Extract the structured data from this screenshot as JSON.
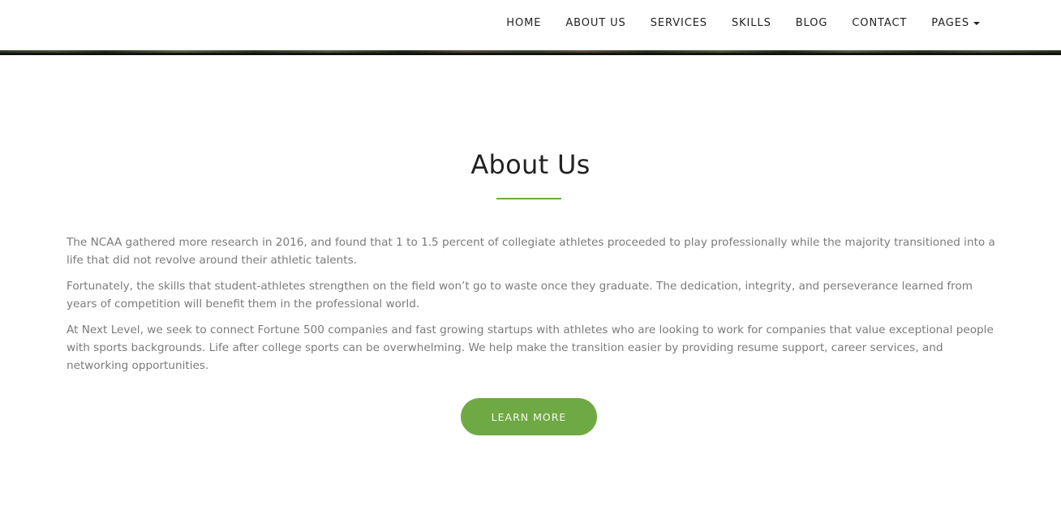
{
  "nav": {
    "items": [
      {
        "label": "HOME"
      },
      {
        "label": "ABOUT US"
      },
      {
        "label": "SERVICES"
      },
      {
        "label": "SKILLS"
      },
      {
        "label": "BLOG"
      },
      {
        "label": "CONTACT"
      },
      {
        "label": "PAGES",
        "icon": "caret-down-icon"
      }
    ]
  },
  "about": {
    "title": "About Us",
    "paragraphs": [
      "The NCAA gathered more research in 2016, and found that 1 to 1.5 percent of collegiate athletes proceeded to play professionally while the majority transitioned into a life that did not revolve around their athletic talents.",
      "Fortunately, the skills that student-athletes strengthen on the field won’t go to waste once they graduate. The dedication, integrity, and perseverance learned from years of competition will benefit them in the professional world.",
      "At Next Level, we seek to connect Fortune 500 companies and fast growing startups with athletes who are looking to work for companies that value exceptional people with sports backgrounds. Life after college sports can be overwhelming. We help make the transition easier by providing resume support, career services, and networking opportunities."
    ],
    "button_label": "LEARN MORE"
  },
  "colors": {
    "accent": "#6fa944",
    "heading": "#222222",
    "body_text": "#7b7b7b"
  }
}
